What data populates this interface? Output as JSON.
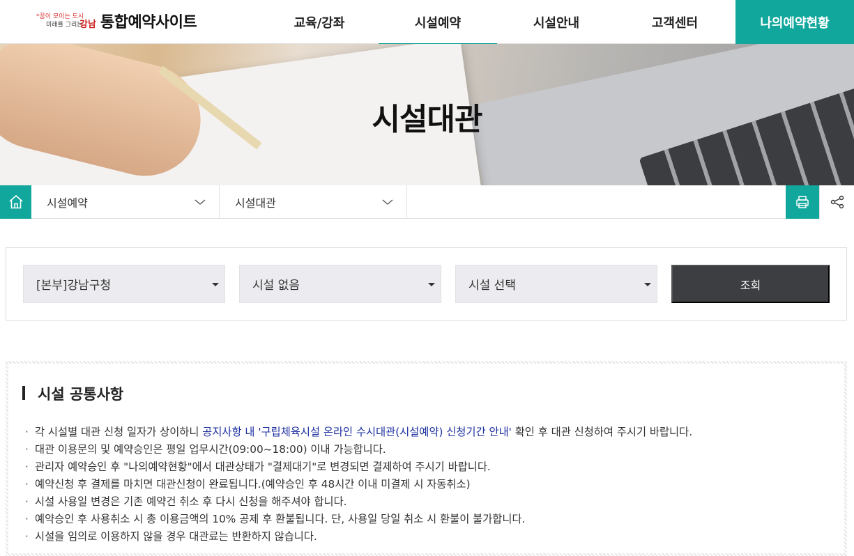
{
  "header": {
    "logo_line1": "*꿈이 모이는 도시",
    "logo_line2": "미래를 그리는",
    "logo_gangnam": "강남",
    "site_title": "통합예약사이트",
    "nav": [
      {
        "label": "교육/강좌",
        "active": false
      },
      {
        "label": "시설예약",
        "active": true
      },
      {
        "label": "시설안내",
        "active": false
      },
      {
        "label": "고객센터",
        "active": false
      }
    ],
    "cta_label": "나의예약현황",
    "accent_color": "#12a79c"
  },
  "banner": {
    "title": "시설대관"
  },
  "location": {
    "home_icon": "home-icon",
    "level1": "시설예약",
    "level2": "시설대관",
    "print_icon": "print-icon",
    "share_icon": "share-icon"
  },
  "search": {
    "select1": "[본부]강남구청",
    "select2": "시설 없음",
    "select3": "시설 선택",
    "button_label": "조회"
  },
  "notice": {
    "title": "시설 공통사항",
    "items": [
      {
        "prefix": "각 시설별 대관 신청 일자가 상이하니 ",
        "link": "공지사항 내 '구립체육시설 온라인 수시대관(시설예약) 신청기간 안내'",
        "suffix": " 확인 후 대관 신청하여 주시기 바랍니다."
      },
      {
        "text": "대관 이용문의 및 예약승인은 평일 업무시간(09:00~18:00) 이내 가능합니다."
      },
      {
        "text": "관리자 예약승인 후 \"나의예약현황\"에서 대관상태가 \"결제대기\"로 변경되면 결제하여 주시기 바랍니다."
      },
      {
        "text": "예약신청 후 결제를 마치면 대관신청이 완료됩니다.(예약승인 후 48시간 이내 미결제 시 자동취소)"
      },
      {
        "text": "시설 사용일 변경은 기존 예약건 취소 후 다시 신청을 해주셔야 합니다."
      },
      {
        "text": "예약승인 후 사용취소 시 총 이용금액의 10% 공제 후 환불됩니다. 단, 사용일 당일 취소 시 환불이 불가합니다."
      },
      {
        "text": "시설을 임의로 이용하지 않을 경우 대관료는 반환하지 않습니다."
      }
    ]
  }
}
